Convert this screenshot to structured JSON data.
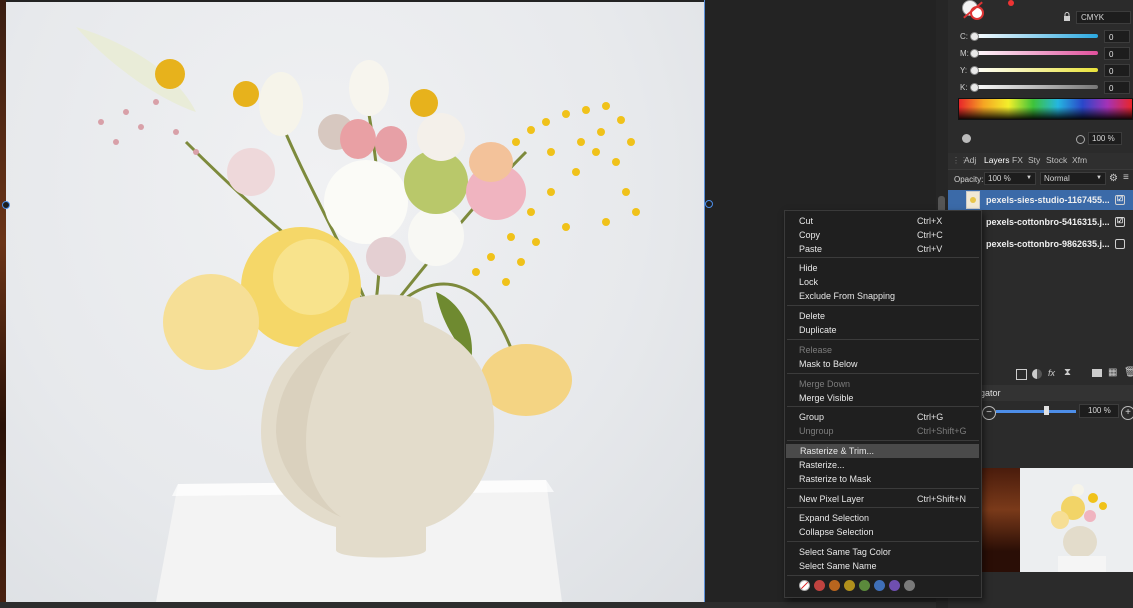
{
  "color_panel": {
    "model": "CMYK",
    "channels": [
      {
        "label": "C:",
        "value": "0",
        "color": "#2aa8e0"
      },
      {
        "label": "M:",
        "value": "0",
        "color": "#e0509c"
      },
      {
        "label": "Y:",
        "value": "0",
        "color": "#e8e23a"
      },
      {
        "label": "K:",
        "value": "0",
        "color": "#777777"
      }
    ],
    "opacity_value": "100 %"
  },
  "tabs": [
    "Adj",
    "Layers",
    "FX",
    "Sty",
    "Stock",
    "Xfm"
  ],
  "layers_panel": {
    "opacity_label": "Opacity:",
    "opacity_value": "100 %",
    "blend_mode": "Normal",
    "layers": [
      {
        "name": "pexels-sies-studio-1167455...",
        "visible": "☑",
        "selected": true
      },
      {
        "name": "pexels-cottonbro-5416315.j...",
        "visible": "☑",
        "selected": false
      },
      {
        "name": "pexels-cottonbro-9862635.j...",
        "visible": "",
        "selected": false
      }
    ]
  },
  "navigator": {
    "title": "gator",
    "zoom": "100 %"
  },
  "context_menu": {
    "items": [
      {
        "label": "Cut",
        "shortcut": "Ctrl+X"
      },
      {
        "label": "Copy",
        "shortcut": "Ctrl+C"
      },
      {
        "label": "Paste",
        "shortcut": "Ctrl+V"
      },
      {
        "label": "Hide",
        "shortcut": ""
      },
      {
        "label": "Lock",
        "shortcut": ""
      },
      {
        "label": "Exclude From Snapping",
        "shortcut": ""
      },
      {
        "label": "Delete",
        "shortcut": ""
      },
      {
        "label": "Duplicate",
        "shortcut": ""
      },
      {
        "label": "Release",
        "shortcut": "",
        "disabled": true
      },
      {
        "label": "Mask to Below",
        "shortcut": ""
      },
      {
        "label": "Merge Down",
        "shortcut": "",
        "disabled": true
      },
      {
        "label": "Merge Visible",
        "shortcut": ""
      },
      {
        "label": "Group",
        "shortcut": "Ctrl+G"
      },
      {
        "label": "Ungroup",
        "shortcut": "Ctrl+Shift+G",
        "disabled": true
      },
      {
        "label": "Rasterize & Trim...",
        "shortcut": "",
        "highlighted": true
      },
      {
        "label": "Rasterize...",
        "shortcut": ""
      },
      {
        "label": "Rasterize to Mask",
        "shortcut": ""
      },
      {
        "label": "New Pixel Layer",
        "shortcut": "Ctrl+Shift+N"
      },
      {
        "label": "Expand Selection",
        "shortcut": ""
      },
      {
        "label": "Collapse Selection",
        "shortcut": ""
      },
      {
        "label": "Select Same Tag Color",
        "shortcut": ""
      },
      {
        "label": "Select Same Name",
        "shortcut": ""
      }
    ],
    "tag_colors": [
      "#c0433f",
      "#b8651e",
      "#b0901c",
      "#5b8a3c",
      "#3f6fb8",
      "#6f4fb0",
      "#7a7a7a"
    ]
  }
}
